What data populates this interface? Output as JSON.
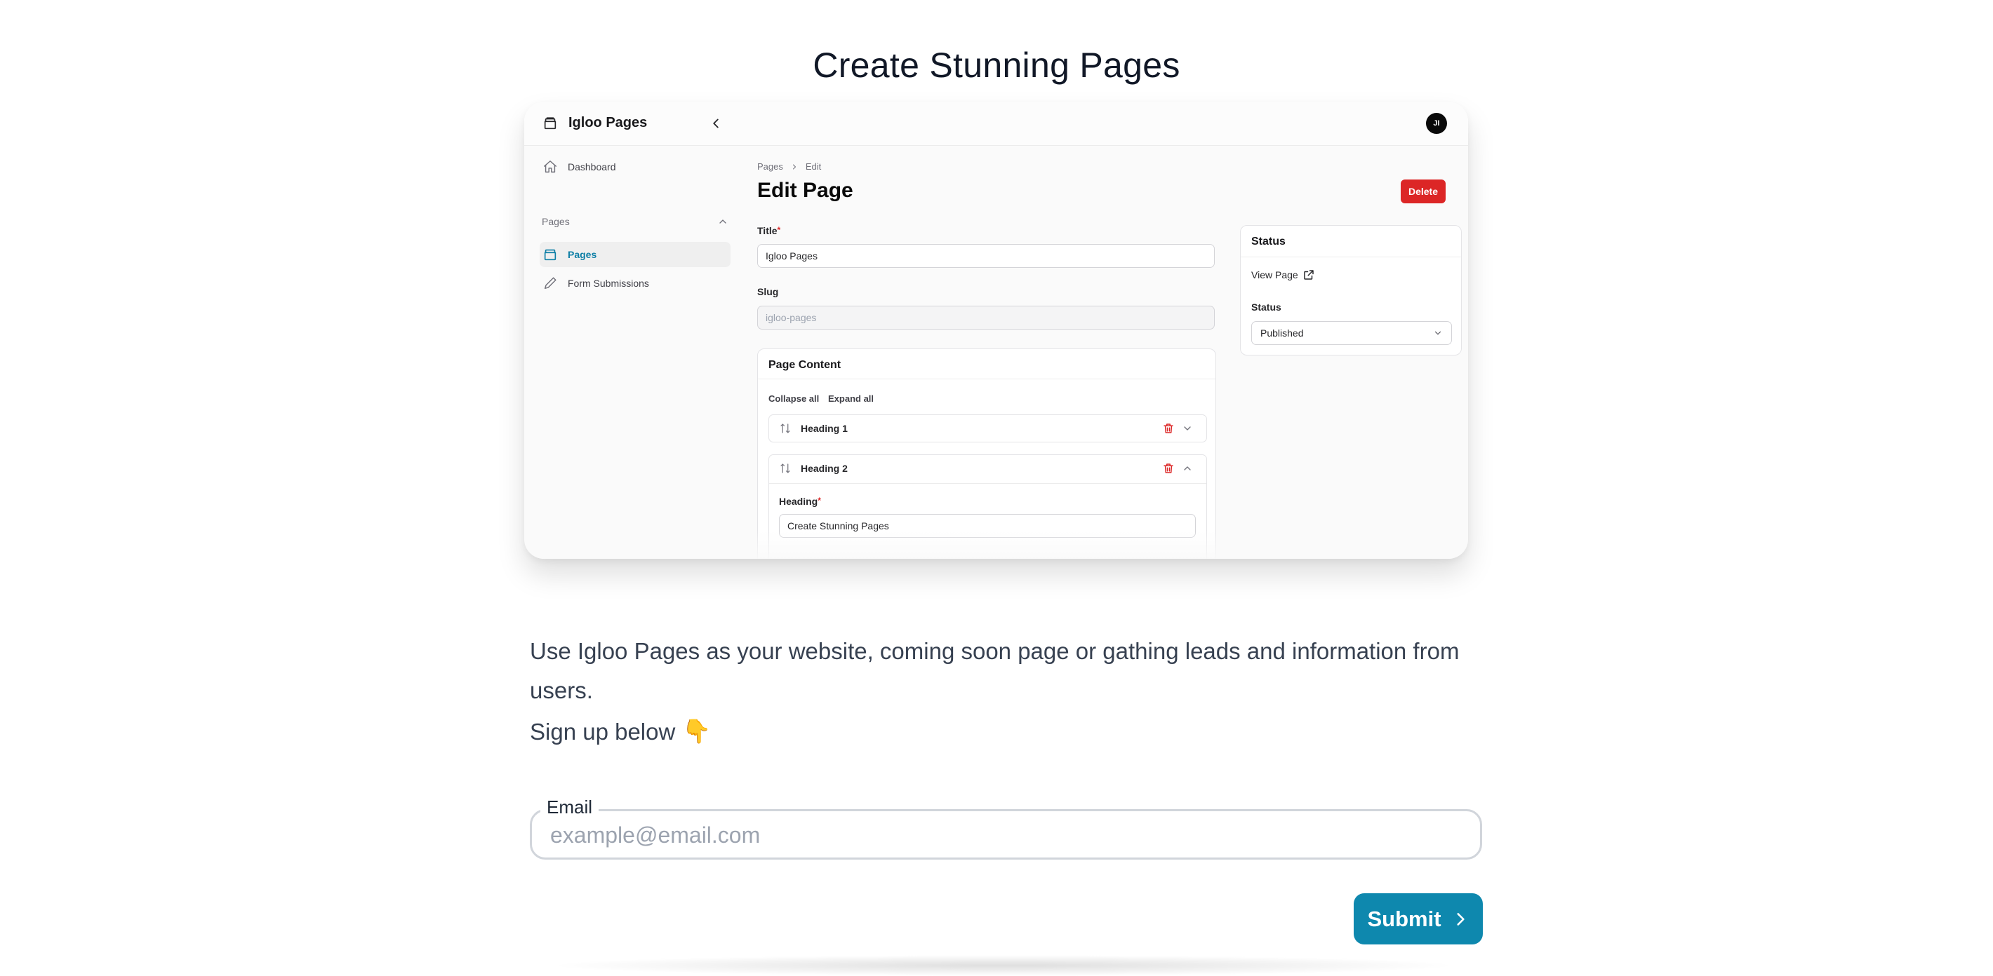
{
  "page": {
    "title": "Create Stunning Pages",
    "lead": "Use Igloo Pages as your website, coming soon page or gathing leads and information from users.",
    "signup": "Sign up below",
    "signup_emoji": "👇"
  },
  "preview": {
    "brand": "Igloo Pages",
    "avatar": "JI",
    "nav": {
      "dashboard": "Dashboard",
      "group": "Pages",
      "pages": "Pages",
      "form_submissions": "Form Submissions"
    },
    "breadcrumb": [
      "Pages",
      "Edit"
    ],
    "heading": "Edit Page",
    "delete_label": "Delete",
    "title_label": "Title",
    "title_value": "Igloo Pages",
    "slug_label": "Slug",
    "slug_value": "igloo-pages",
    "content_card": {
      "title": "Page Content",
      "collapse_all": "Collapse all",
      "expand_all": "Expand all",
      "blocks": [
        {
          "title": "Heading 1"
        },
        {
          "title": "Heading 2"
        }
      ],
      "heading_label": "Heading",
      "heading_value": "Create Stunning Pages"
    },
    "status_card": {
      "title": "Status",
      "view_page": "View Page",
      "status_label": "Status",
      "status_value": "Published"
    }
  },
  "form": {
    "email_label": "Email",
    "email_placeholder": "example@email.com",
    "submit_label": "Submit"
  },
  "colors": {
    "accent": "#0e88ae",
    "danger": "#dc2626",
    "active_nav": "#0e7fa6"
  }
}
